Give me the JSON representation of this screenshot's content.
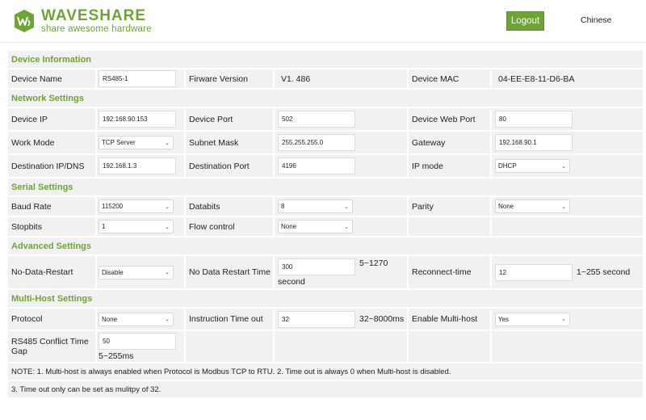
{
  "header": {
    "brand": "WAVESHARE",
    "tagline": "share awesome hardware",
    "logout_label": "Logout",
    "language_link": "Chinese",
    "brand_color": "#6ea336"
  },
  "device_info": {
    "title": "Device Information",
    "device_name_label": "Device Name",
    "device_name": "RS485-1",
    "firmware_label": "Firware Version",
    "firmware": "V1. 486",
    "mac_label": "Device MAC",
    "mac": "04-EE-E8-11-D6-BA"
  },
  "network": {
    "title": "Network Settings",
    "device_ip_label": "Device IP",
    "device_ip": "192.168.90.153",
    "device_port_label": "Device Port",
    "device_port": "502",
    "web_port_label": "Device Web Port",
    "web_port": "80",
    "work_mode_label": "Work Mode",
    "work_mode": "TCP Server",
    "subnet_label": "Subnet Mask",
    "subnet": "255.255.255.0",
    "gateway_label": "Gateway",
    "gateway": "192.168.90.1",
    "dest_ip_label": "Destination IP/DNS",
    "dest_ip": "192.168.1.3",
    "dest_port_label": "Destination Port",
    "dest_port": "4196",
    "ip_mode_label": "IP mode",
    "ip_mode": "DHCP"
  },
  "serial": {
    "title": "Serial Settings",
    "baud_label": "Baud Rate",
    "baud": "115200",
    "databits_label": "Databits",
    "databits": "8",
    "parity_label": "Parity",
    "parity": "None",
    "stopbits_label": "Stopbits",
    "stopbits": "1",
    "flow_label": "Flow control",
    "flow": "None"
  },
  "advanced": {
    "title": "Advanced Settings",
    "ndr_label": "No-Data-Restart",
    "ndr": "Disable",
    "ndr_time_label": "No Data Restart Time",
    "ndr_time": "300",
    "ndr_time_range": "5~1270",
    "ndr_time_unit": "second",
    "reconnect_label": "Reconnect-time",
    "reconnect": "12",
    "reconnect_range": "1~255 second"
  },
  "multihost": {
    "title": "Multi-Host Settings",
    "protocol_label": "Protocol",
    "protocol": "None",
    "timeout_label": "Instruction Time out",
    "timeout": "32",
    "timeout_range": "32~8000ms",
    "enable_label": "Enable Multi-host",
    "enable": "Yes",
    "conflict_label": "RS485 Conflict Time Gap",
    "conflict": "50",
    "conflict_range": "5~255ms"
  },
  "notes": {
    "line1": "NOTE: 1. Multi-host is always enabled when Protocol is Modbus TCP to RTU. 2. Time out is always 0 when Multi-host is disabled.",
    "line2": "3. Time out only can be set as mulitpy of 32."
  }
}
